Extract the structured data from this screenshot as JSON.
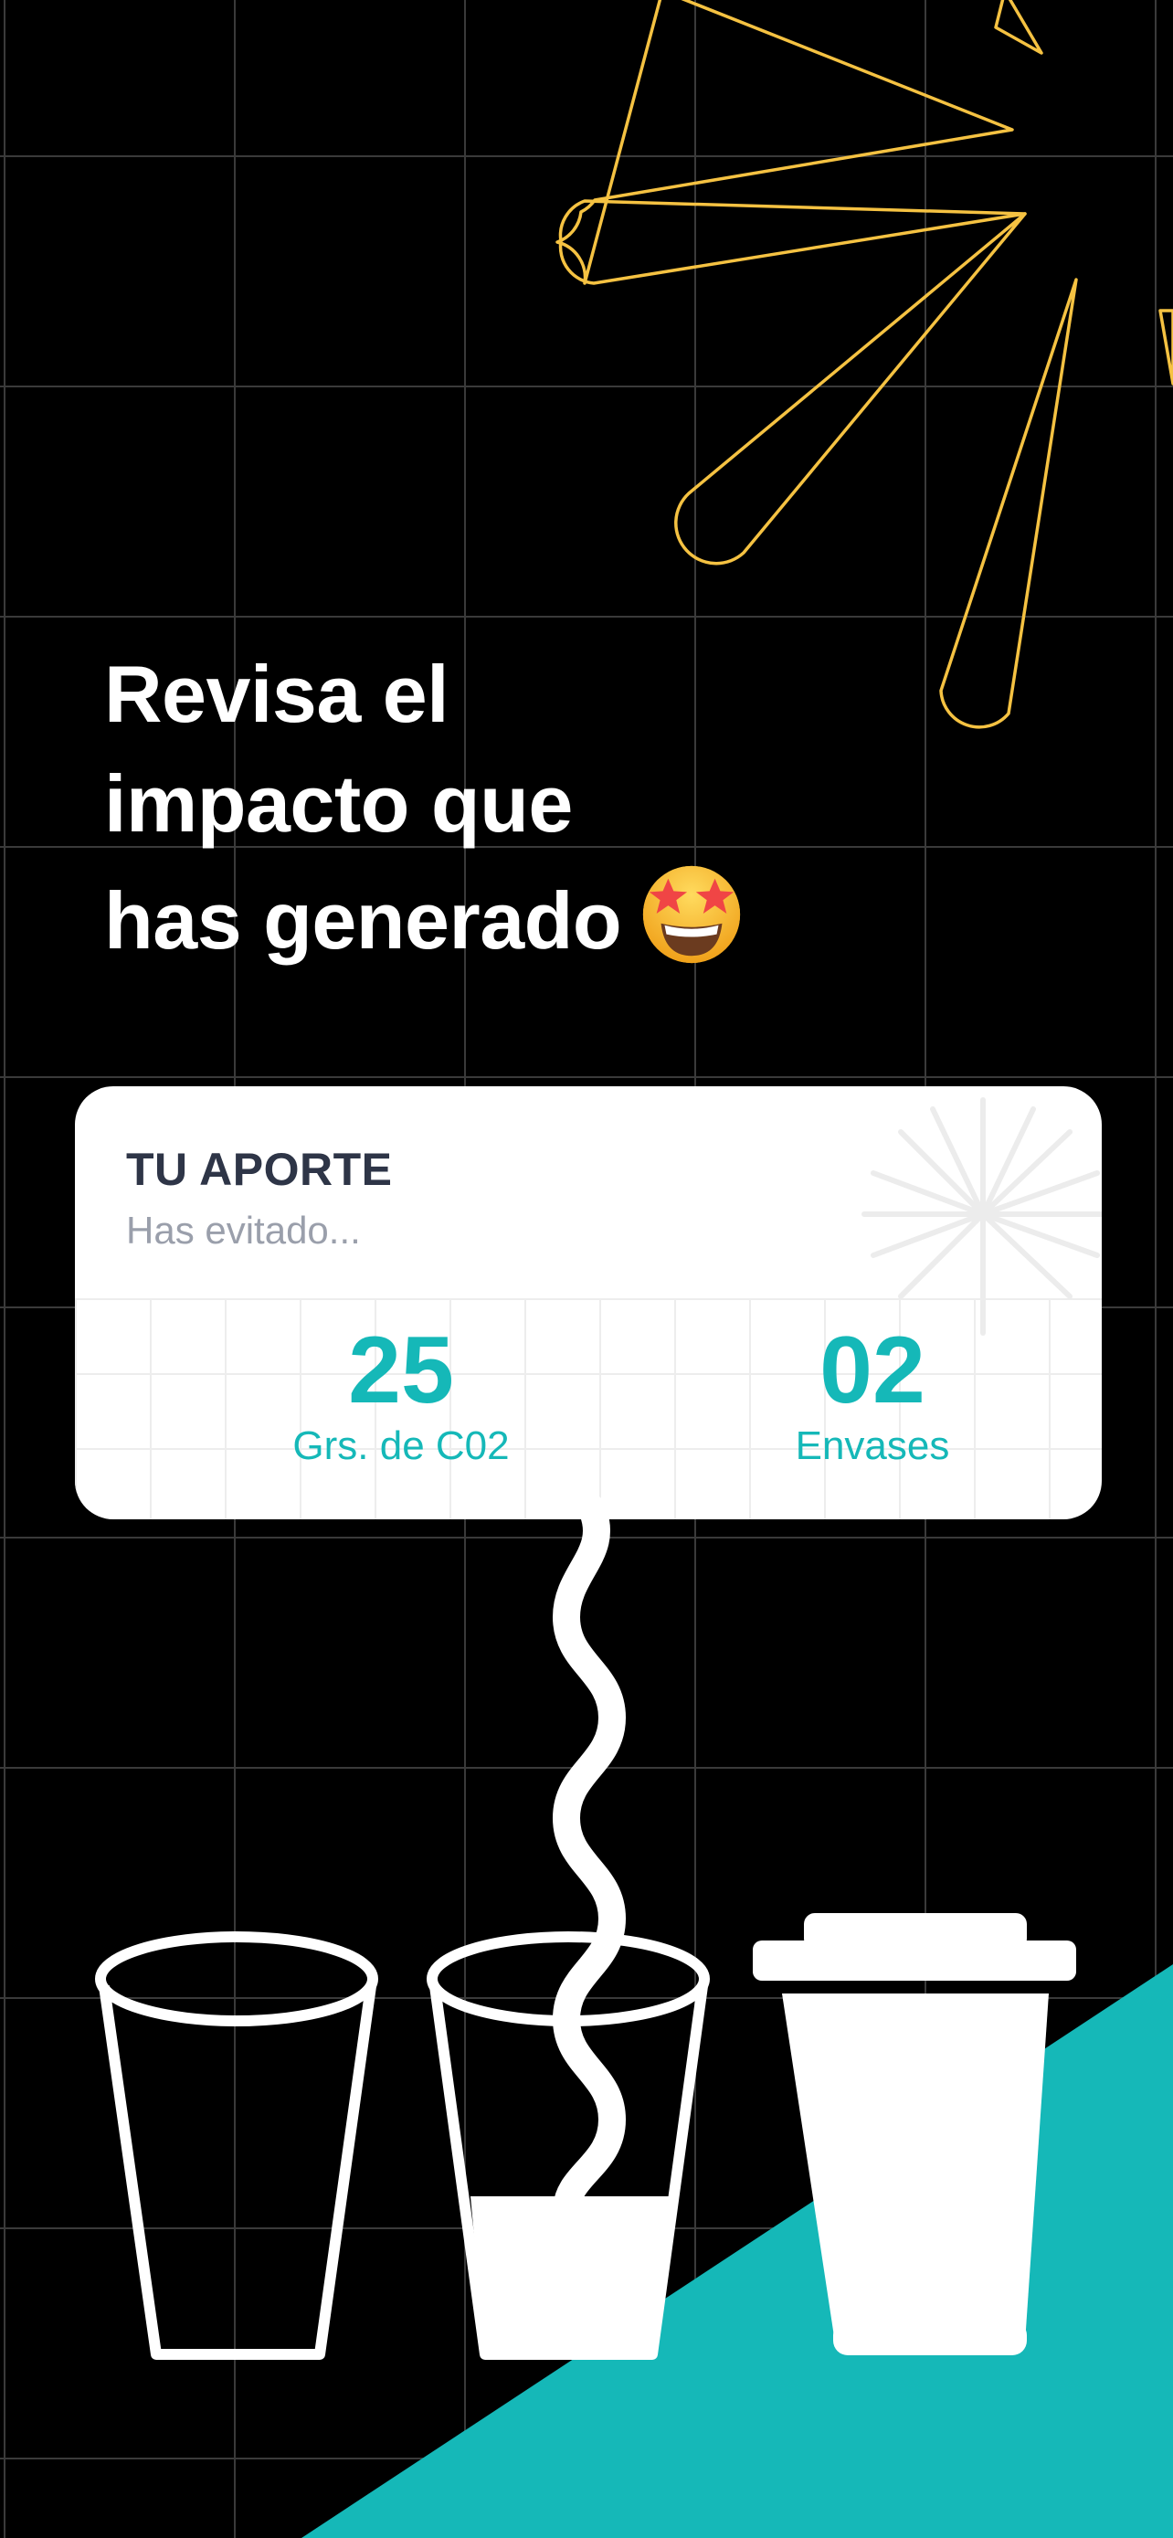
{
  "screen": {
    "headline_lines": [
      "Revisa el",
      "impacto que",
      "has generado"
    ],
    "headline_emoji": "star-struck-emoji"
  },
  "card": {
    "title": "TU APORTE",
    "subtitle": "Has evitado...",
    "stats": [
      {
        "value": "25",
        "label": "Grs. de C02"
      },
      {
        "value": "02",
        "label": "Envases"
      }
    ]
  },
  "colors": {
    "background": "#000000",
    "accent_teal": "#15B8B8",
    "sun_outline": "#F5C242",
    "card_background": "#FFFFFF",
    "card_title": "#2E3547",
    "card_subtitle": "#9A9FAB"
  },
  "icons": [
    "sun-rays-outline",
    "card-star-watermark",
    "empty-glass-icon",
    "half-full-glass-icon",
    "coffee-cup-icon",
    "wavy-straw-icon"
  ]
}
